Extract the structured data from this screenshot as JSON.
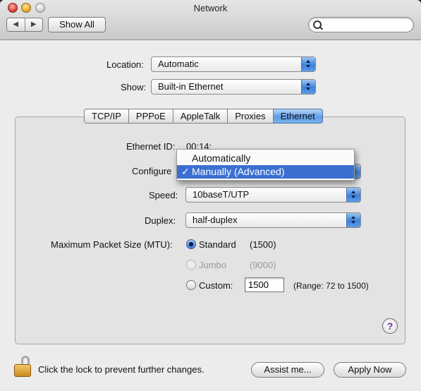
{
  "window": {
    "title": "Network"
  },
  "toolbar": {
    "back_glyph": "◀",
    "forward_glyph": "▶",
    "show_all_label": "Show All",
    "search_placeholder": ""
  },
  "location": {
    "label": "Location:",
    "value": "Automatic"
  },
  "show": {
    "label": "Show:",
    "value": "Built-in Ethernet"
  },
  "tabs": [
    {
      "label": "TCP/IP",
      "selected": false
    },
    {
      "label": "PPPoE",
      "selected": false
    },
    {
      "label": "AppleTalk",
      "selected": false
    },
    {
      "label": "Proxies",
      "selected": false
    },
    {
      "label": "Ethernet",
      "selected": true
    }
  ],
  "ethernet": {
    "id_label": "Ethernet ID:",
    "id_value": "00:14:",
    "configure_label": "Configure",
    "configure_options": [
      {
        "label": "Automatically",
        "selected": false
      },
      {
        "label": "Manually (Advanced)",
        "selected": true
      }
    ],
    "check_glyph": "✓",
    "speed_label": "Speed:",
    "speed_value": "10baseT/UTP",
    "duplex_label": "Duplex:",
    "duplex_value": "half-duplex",
    "mtu_label": "Maximum Packet Size (MTU):",
    "mtu_options": [
      {
        "label": "Standard",
        "value": "(1500)",
        "selected": true,
        "enabled": true
      },
      {
        "label": "Jumbo",
        "value": "(9000)",
        "selected": false,
        "enabled": false
      },
      {
        "label": "Custom:",
        "value": "1500",
        "selected": false,
        "enabled": true,
        "range": "(Range: 72 to 1500)"
      }
    ]
  },
  "help_label": "?",
  "footer": {
    "lock_text": "Click the lock to prevent further changes.",
    "assist_label": "Assist me...",
    "apply_label": "Apply Now"
  }
}
